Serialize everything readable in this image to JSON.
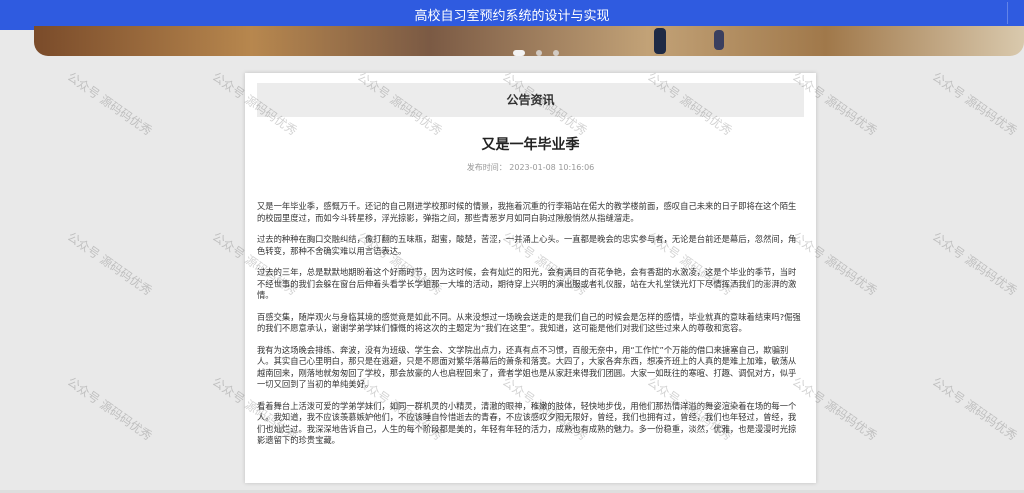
{
  "site": {
    "title": "高校自习室预约系统的设计与实现"
  },
  "banner": {
    "dots_count": 3,
    "active_dot": 1
  },
  "section": {
    "title": "公告资讯"
  },
  "article": {
    "title": "又是一年毕业季",
    "publish_label": "发布时间：",
    "publish_time": "2023-01-08 10:16:06",
    "paragraphs": [
      "又是一年毕业季，感慨万千。还记的自己刚进学校那时候的情景，我拖着沉重的行李箱站在偌大的教学楼前面，感叹自己未来的日子即将在这个陌生的校园里度过，而如今斗转星移，浮光掠影，弹指之间，那些青葱岁月如同白驹过隙般悄然从指缝溜走。",
      "过去的种种在胸口交融纠结，像打翻的五味瓶，甜蜜，酸楚，苦涩，一并涌上心头。一直都是晚会的忠实参与者，无论是台前还是幕后，忽然间，角色转变，那种不舍确实难以用言语表达。",
      "过去的三年，总是默默地期盼着这个好雨时节，因为这时候，会有灿烂的阳光，会有满目的百花争艳，会有香甜的水激凌，这是个毕业的季节，当时不经世事的我们会躲在窗台后伸着头看学长学姐那一大堆的活动，期待穿上兴明的演出服或者礼仪服，站在大礼堂镁光灯下尽情挥洒我们的澎湃的激情。",
      "百感交集，随岸观火与身临其境的感觉竟是如此不同。从来没想过一场晚会送走的是我们自己的时候会是怎样的感情，毕业就真的意味着结束吗?倔强的我们不愿意承认，谢谢学弟学妹们慷慨的将这次的主题定为“我们在这里”。我知道，这可能是他们对我们这些过来人的尊敬和宽容。",
      "我有为这场晚会排练、奔波，没有为班级、学生会、文学院出点力，还真有点不习惯，百般无奈中，用“工作忙”个万能的借口来搪塞自己，欺骗别人。其实自己心里明白，那只是在逃避，只是不愿面对繁华落幕后的萧条和落寞。大四了，大家各奔东西，想凑齐班上的人真的是难上加难，敏荡从越南回来，刚落地就匆匆回了学校，那会放豪的人也启程回来了，聋者学姐也是从家赶来得我们团圆。大家一如既往的寒暄、打趣、调侃对方，似乎一切又回到了当初的单纯美好。",
      "看着舞台上活泼可爱的学弟学妹们，如同一群机灵的小精灵，清澈的眼神，稚嫩的肢体，轻快地步伐，用他们那热情洋溢的舞姿渲染着在场的每一个人。我知道，我不应该羡慕嫉妒他们，不应该睡自怜惜逝去的青春，不应该感叹夕阳无限好，曾经，我们也拥有过，曾经，我们也年轻过，曾经，我们也灿烂过。我深深地告诉自己，人生的每个阶段都是美的，年轻有年轻的活力，成熟也有成熟的魅力。多一份稳重，淡然，优雅，也是漫漫时光掠影遗留下的珍贵宝藏。"
    ]
  },
  "watermark": {
    "text": "公众号 源码码优秀"
  }
}
